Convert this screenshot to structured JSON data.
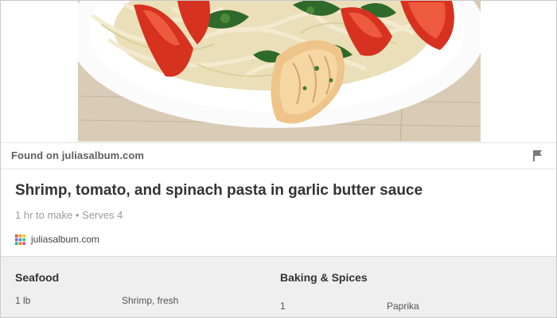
{
  "pin": {
    "image_alt": "Shrimp, tomato and spinach pasta on a white plate",
    "found_on_prefix": "Found on",
    "found_on_domain": "juliasalbum.com",
    "title": "Shrimp, tomato, and spinach pasta in garlic butter sauce",
    "meta": "1 hr to make • Serves 4",
    "site_name": "juliasalbum.com",
    "icons": {
      "report": "flag-icon",
      "site": "color-grid-icon"
    }
  },
  "ingredients": {
    "groups": [
      {
        "heading": "Seafood",
        "items": [
          {
            "qty": "1 lb",
            "name": "Shrimp, fresh"
          }
        ]
      },
      {
        "heading": "Baking & Spices",
        "items": [
          {
            "qty": "1",
            "name": "Paprika"
          }
        ]
      }
    ]
  },
  "colors": {
    "background": "#ffffff",
    "ingredients_bg": "#efefef",
    "title_text": "#333333",
    "meta_text": "#9a9a9a"
  }
}
